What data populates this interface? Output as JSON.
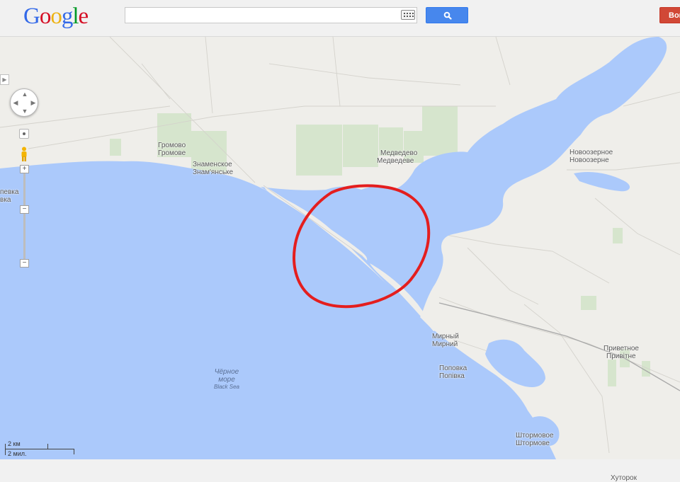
{
  "header": {
    "logo_letters": [
      {
        "ch": "G",
        "color": "#3369e8"
      },
      {
        "ch": "o",
        "color": "#d50f25"
      },
      {
        "ch": "o",
        "color": "#eeb211"
      },
      {
        "ch": "g",
        "color": "#3369e8"
      },
      {
        "ch": "l",
        "color": "#009925"
      },
      {
        "ch": "e",
        "color": "#d50f25"
      }
    ],
    "search_value": "",
    "search_icon": "magnifier-icon",
    "keyboard_icon": "keyboard-icon",
    "signin_label": "Вой"
  },
  "colors": {
    "water": "#abc9fb",
    "land": "#efeeea",
    "green": "#d6e5cd",
    "annotation": "#e41e1e",
    "accent_blue": "#4787ed",
    "signin_red": "#d14836"
  },
  "map": {
    "places": {
      "gromovo_ru": "Громово",
      "gromovo_uk": "Громове",
      "znamenskoe_ru": "Знаменское",
      "znamenskoe_uk": "Знам'янське",
      "medvedevo_ru": "Медведево",
      "medvedevo_uk": "Медведеве",
      "novoozernoe_ru": "Новоозерное",
      "novoozernoe_uk": "Новоозерне",
      "mirny_ru": "Мирный",
      "mirny_uk": "Мирний",
      "popovka_ru": "Поповка",
      "popovka_uk": "Попівка",
      "privetnoe_ru": "Приветное",
      "privetnoe_uk": "Привітне",
      "shtormovoe_ru": "Штормовое",
      "shtormovoe_uk": "Штормове",
      "khutorok": "Хуторок",
      "left_edge_1": "певка",
      "left_edge_2": "вка"
    },
    "sea": {
      "name_ru_1": "Чёрное",
      "name_ru_2": "море",
      "name_en": "Black Sea"
    },
    "controls": {
      "pan_arrows": [
        "▲",
        "◀",
        "▶",
        "▼"
      ],
      "zoom_plus": "+",
      "zoom_minus": "−",
      "collapse": "▶"
    },
    "scale": {
      "metric": "2 км",
      "imperial": "2 мил."
    }
  }
}
